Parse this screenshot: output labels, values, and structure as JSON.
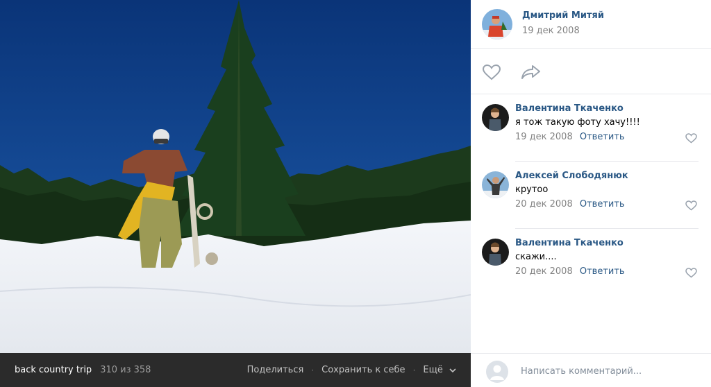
{
  "photo": {
    "alt": ""
  },
  "viewer_footer": {
    "album_title": "back country trip",
    "counter": "310 из 358",
    "share_label": "Поделиться",
    "save_label": "Сохранить к себе",
    "more_label": "Ещё"
  },
  "post": {
    "author_name": "Дмитрий Митяй",
    "date": "19 дек 2008"
  },
  "actions": {
    "like_icon": "heart-outline-icon",
    "share_icon": "share-arrow-icon"
  },
  "comments": [
    {
      "author": "Валентина Ткаченко",
      "text": "я тож такую фоту хачу!!!!",
      "date": "19 дек 2008",
      "reply_label": "Ответить"
    },
    {
      "author": "Алексей Слободянюк",
      "text": "крутоо",
      "date": "20 дек 2008",
      "reply_label": "Ответить"
    },
    {
      "author": "Валентина Ткаченко",
      "text": "скажи....",
      "date": "20 дек 2008",
      "reply_label": "Ответить"
    }
  ],
  "composer": {
    "placeholder": "Написать комментарий...",
    "value": ""
  },
  "colors": {
    "link": "#2a5885",
    "muted": "#828282",
    "footer_bg": "#2b2b2b",
    "sky": "#0d3f8c"
  }
}
